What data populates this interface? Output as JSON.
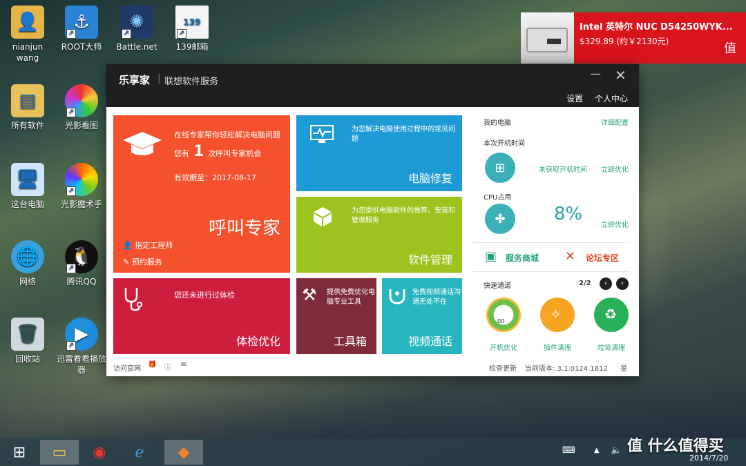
{
  "desktop": {
    "icons": [
      {
        "label": "nianjun\nwang",
        "icon": "user-folder-icon"
      },
      {
        "label": "ROOT大师",
        "icon": "anchor-icon"
      },
      {
        "label": "Battle.net",
        "icon": "battlenet-icon"
      },
      {
        "label": "139邮箱",
        "icon": "mail-file-icon"
      },
      {
        "label": "所有软件",
        "icon": "folder-icon"
      },
      {
        "label": "光影看图",
        "icon": "photo-viewer-icon"
      },
      {
        "label": "这台电脑",
        "icon": "computer-icon"
      },
      {
        "label": "光影魔术手",
        "icon": "photo-editor-icon"
      },
      {
        "label": "网络",
        "icon": "network-icon"
      },
      {
        "label": "腾讯QQ",
        "icon": "qq-icon"
      },
      {
        "label": "回收站",
        "icon": "recycle-bin-icon"
      },
      {
        "label": "迅雷看看播放器",
        "icon": "player-icon"
      }
    ]
  },
  "ad": {
    "title": "Intel 英特尔 NUC D54250WYK...",
    "price": "$329.89 (约￥2130元)",
    "badge": "值"
  },
  "app": {
    "logo": "乐享家",
    "separator": "|",
    "subtitle": "联想软件服务",
    "min_glyph": "—",
    "close_glyph": "✕",
    "settings_label": "设置",
    "user_center_label": "个人中心",
    "expert": {
      "line1": "在线专家帮你轻松解决电脑问题",
      "line2_prefix": "您有",
      "line2_count": "1",
      "line2_suffix": "次呼叫专家机会",
      "valid_until": "有效期至：2017-08-17",
      "title": "呼叫专家",
      "link_engineer": "指定工程师",
      "link_booking": "预约服务"
    },
    "repair": {
      "desc": "为您解决电脑使用过程中的常见问题",
      "title": "电脑修复"
    },
    "software": {
      "desc": "为您提供电脑软件的推荐、安装和管理服务",
      "title": "软件管理"
    },
    "checkup": {
      "desc": "您还未进行过体检",
      "title": "体检优化"
    },
    "tools": {
      "desc": "提供免费优化电脑专业工具",
      "title": "工具箱"
    },
    "video": {
      "desc": "免费视频通话沟通无处不在",
      "title": "视频通话"
    },
    "mypc": {
      "title": "我的电脑",
      "detail_link": "详细配置",
      "boot_label": "本次开机时间",
      "boot_value": "未获取开机时间",
      "optimize_1": "立即优化",
      "cpu_label": "CPU占用",
      "cpu_value": "8%",
      "optimize_2": "立即优化"
    },
    "services": {
      "store": "服务商城",
      "forum": "论坛专区"
    },
    "quick": {
      "title": "快速通道",
      "page": "2/2",
      "prev": "‹",
      "next": "›",
      "items": [
        "开机优化",
        "插件清理",
        "垃圾清理"
      ],
      "dial_value": "00"
    },
    "footer": {
      "website": "访问官网",
      "check_update": "检查更新",
      "version": "当前版本: 3.1.0124.1812",
      "corner": "旻"
    }
  },
  "taskbar": {
    "date": "2014/7/20",
    "watermark": "值 什么值得买"
  }
}
